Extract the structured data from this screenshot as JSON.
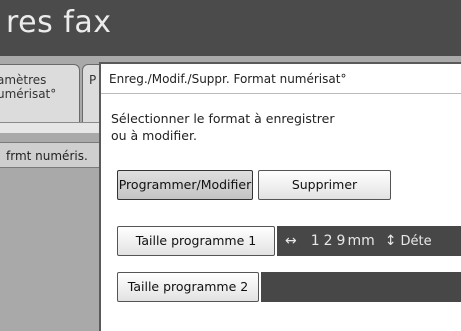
{
  "header": {
    "title": "res fax"
  },
  "background": {
    "tab1_label_line1": "amètres",
    "tab1_label_line2": "umérisat°",
    "tab2_label": "P",
    "side_label": "frmt numéris."
  },
  "dialog": {
    "title": "Enreg./Modif./Suppr. Format numérisat°",
    "instruction_line1": "Sélectionner le format à enregistrer",
    "instruction_line2": "ou à modifier.",
    "program_modify_label": "Programmer/Modifier",
    "delete_label": "Supprimer",
    "size1": {
      "label": "Taille programme 1",
      "arrow_h": "↔",
      "value": "129",
      "unit": "mm",
      "arrow_v": "↕",
      "trailing": "Déte"
    },
    "size2": {
      "label": "Taille programme 2"
    }
  },
  "colors": {
    "topbar": "#4b4b4b",
    "background_panel": "#a9a9a9",
    "size_bar": "#474747"
  },
  "icons": {
    "horizontal": "left-right-arrow-icon",
    "vertical": "up-down-arrow-icon"
  }
}
